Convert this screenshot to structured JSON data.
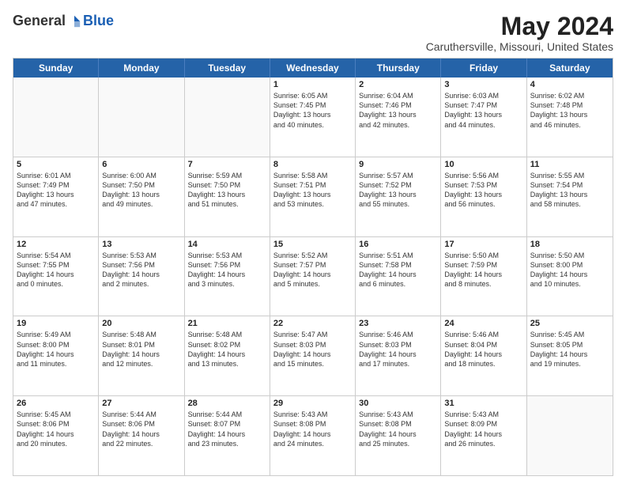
{
  "header": {
    "logo_general": "General",
    "logo_blue": "Blue",
    "month_title": "May 2024",
    "location": "Caruthersville, Missouri, United States"
  },
  "weekdays": [
    "Sunday",
    "Monday",
    "Tuesday",
    "Wednesday",
    "Thursday",
    "Friday",
    "Saturday"
  ],
  "rows": [
    [
      {
        "day": "",
        "info": "",
        "empty": true
      },
      {
        "day": "",
        "info": "",
        "empty": true
      },
      {
        "day": "",
        "info": "",
        "empty": true
      },
      {
        "day": "1",
        "info": "Sunrise: 6:05 AM\nSunset: 7:45 PM\nDaylight: 13 hours\nand 40 minutes."
      },
      {
        "day": "2",
        "info": "Sunrise: 6:04 AM\nSunset: 7:46 PM\nDaylight: 13 hours\nand 42 minutes."
      },
      {
        "day": "3",
        "info": "Sunrise: 6:03 AM\nSunset: 7:47 PM\nDaylight: 13 hours\nand 44 minutes."
      },
      {
        "day": "4",
        "info": "Sunrise: 6:02 AM\nSunset: 7:48 PM\nDaylight: 13 hours\nand 46 minutes."
      }
    ],
    [
      {
        "day": "5",
        "info": "Sunrise: 6:01 AM\nSunset: 7:49 PM\nDaylight: 13 hours\nand 47 minutes."
      },
      {
        "day": "6",
        "info": "Sunrise: 6:00 AM\nSunset: 7:50 PM\nDaylight: 13 hours\nand 49 minutes."
      },
      {
        "day": "7",
        "info": "Sunrise: 5:59 AM\nSunset: 7:50 PM\nDaylight: 13 hours\nand 51 minutes."
      },
      {
        "day": "8",
        "info": "Sunrise: 5:58 AM\nSunset: 7:51 PM\nDaylight: 13 hours\nand 53 minutes."
      },
      {
        "day": "9",
        "info": "Sunrise: 5:57 AM\nSunset: 7:52 PM\nDaylight: 13 hours\nand 55 minutes."
      },
      {
        "day": "10",
        "info": "Sunrise: 5:56 AM\nSunset: 7:53 PM\nDaylight: 13 hours\nand 56 minutes."
      },
      {
        "day": "11",
        "info": "Sunrise: 5:55 AM\nSunset: 7:54 PM\nDaylight: 13 hours\nand 58 minutes."
      }
    ],
    [
      {
        "day": "12",
        "info": "Sunrise: 5:54 AM\nSunset: 7:55 PM\nDaylight: 14 hours\nand 0 minutes."
      },
      {
        "day": "13",
        "info": "Sunrise: 5:53 AM\nSunset: 7:56 PM\nDaylight: 14 hours\nand 2 minutes."
      },
      {
        "day": "14",
        "info": "Sunrise: 5:53 AM\nSunset: 7:56 PM\nDaylight: 14 hours\nand 3 minutes."
      },
      {
        "day": "15",
        "info": "Sunrise: 5:52 AM\nSunset: 7:57 PM\nDaylight: 14 hours\nand 5 minutes."
      },
      {
        "day": "16",
        "info": "Sunrise: 5:51 AM\nSunset: 7:58 PM\nDaylight: 14 hours\nand 6 minutes."
      },
      {
        "day": "17",
        "info": "Sunrise: 5:50 AM\nSunset: 7:59 PM\nDaylight: 14 hours\nand 8 minutes."
      },
      {
        "day": "18",
        "info": "Sunrise: 5:50 AM\nSunset: 8:00 PM\nDaylight: 14 hours\nand 10 minutes."
      }
    ],
    [
      {
        "day": "19",
        "info": "Sunrise: 5:49 AM\nSunset: 8:00 PM\nDaylight: 14 hours\nand 11 minutes."
      },
      {
        "day": "20",
        "info": "Sunrise: 5:48 AM\nSunset: 8:01 PM\nDaylight: 14 hours\nand 12 minutes."
      },
      {
        "day": "21",
        "info": "Sunrise: 5:48 AM\nSunset: 8:02 PM\nDaylight: 14 hours\nand 13 minutes."
      },
      {
        "day": "22",
        "info": "Sunrise: 5:47 AM\nSunset: 8:03 PM\nDaylight: 14 hours\nand 15 minutes."
      },
      {
        "day": "23",
        "info": "Sunrise: 5:46 AM\nSunset: 8:03 PM\nDaylight: 14 hours\nand 17 minutes."
      },
      {
        "day": "24",
        "info": "Sunrise: 5:46 AM\nSunset: 8:04 PM\nDaylight: 14 hours\nand 18 minutes."
      },
      {
        "day": "25",
        "info": "Sunrise: 5:45 AM\nSunset: 8:05 PM\nDaylight: 14 hours\nand 19 minutes."
      }
    ],
    [
      {
        "day": "26",
        "info": "Sunrise: 5:45 AM\nSunset: 8:06 PM\nDaylight: 14 hours\nand 20 minutes."
      },
      {
        "day": "27",
        "info": "Sunrise: 5:44 AM\nSunset: 8:06 PM\nDaylight: 14 hours\nand 22 minutes."
      },
      {
        "day": "28",
        "info": "Sunrise: 5:44 AM\nSunset: 8:07 PM\nDaylight: 14 hours\nand 23 minutes."
      },
      {
        "day": "29",
        "info": "Sunrise: 5:43 AM\nSunset: 8:08 PM\nDaylight: 14 hours\nand 24 minutes."
      },
      {
        "day": "30",
        "info": "Sunrise: 5:43 AM\nSunset: 8:08 PM\nDaylight: 14 hours\nand 25 minutes."
      },
      {
        "day": "31",
        "info": "Sunrise: 5:43 AM\nSunset: 8:09 PM\nDaylight: 14 hours\nand 26 minutes."
      },
      {
        "day": "",
        "info": "",
        "empty": true
      }
    ]
  ]
}
